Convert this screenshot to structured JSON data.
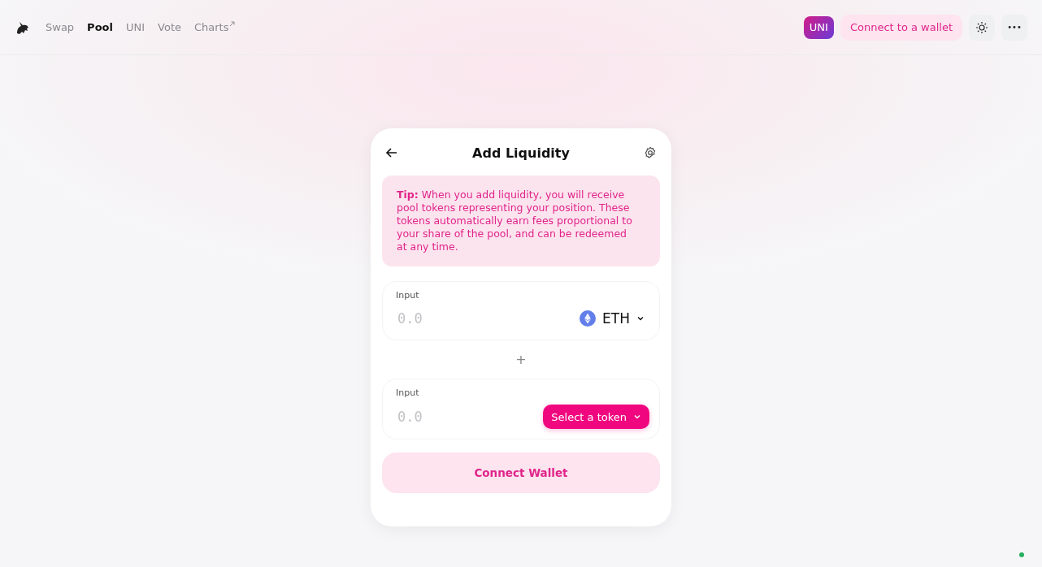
{
  "nav": {
    "items": [
      {
        "label": "Swap",
        "selected": false,
        "external": false
      },
      {
        "label": "Pool",
        "selected": true,
        "external": false
      },
      {
        "label": "UNI",
        "selected": false,
        "external": false
      },
      {
        "label": "Vote",
        "selected": false,
        "external": false
      },
      {
        "label": "Charts",
        "selected": false,
        "external": true
      }
    ],
    "uni_badge": "UNI",
    "connect_button": "Connect to a wallet",
    "more_button": "•••"
  },
  "card": {
    "title": "Add Liquidity",
    "tip": "**Tip:** When you add liquidity, you will receive pool tokens representing your position. These tokens automatically earn fees proportional to your share of the pool, and can be redeemed at any time.",
    "inputs": [
      {
        "label": "Input",
        "placeholder": "0.0",
        "kind": "token",
        "token": "ETH"
      },
      {
        "label": "Input",
        "placeholder": "0.0",
        "kind": "select",
        "token": "Select a token"
      }
    ],
    "plus": "+",
    "submit": "Connect Wallet"
  }
}
